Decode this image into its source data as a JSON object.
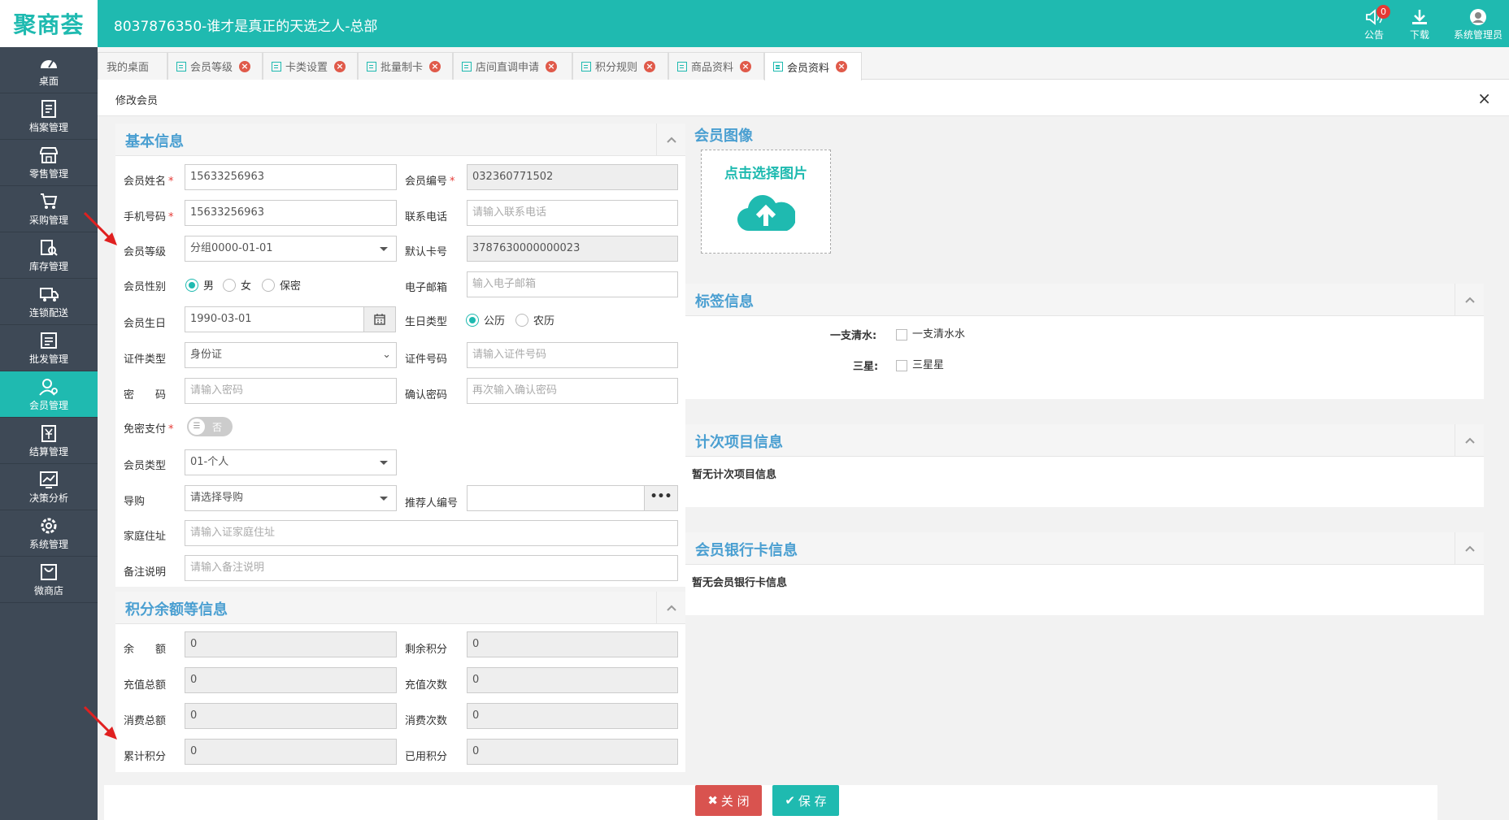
{
  "app": {
    "logo_text": "聚商荟",
    "shop_title": "8037876350-谁才是真正的天选之人-总部",
    "notice_label": "公告",
    "notice_count": "0",
    "download_label": "下载",
    "user_label": "系统管理员"
  },
  "sidebar": {
    "items": [
      {
        "label": "桌面",
        "icon": "dashboard-icon"
      },
      {
        "label": "档案管理",
        "icon": "archive-icon"
      },
      {
        "label": "零售管理",
        "icon": "store-icon"
      },
      {
        "label": "采购管理",
        "icon": "cart-icon"
      },
      {
        "label": "库存管理",
        "icon": "inventory-icon"
      },
      {
        "label": "连锁配送",
        "icon": "truck-icon"
      },
      {
        "label": "批发管理",
        "icon": "wholesale-icon"
      },
      {
        "label": "会员管理",
        "icon": "member-icon"
      },
      {
        "label": "结算管理",
        "icon": "settlement-icon"
      },
      {
        "label": "决策分析",
        "icon": "chart-icon"
      },
      {
        "label": "系统管理",
        "icon": "gear-icon"
      },
      {
        "label": "微商店",
        "icon": "shop-bag-icon"
      }
    ]
  },
  "tabs": [
    {
      "label": "我的桌面"
    },
    {
      "label": "会员等级"
    },
    {
      "label": "卡类设置"
    },
    {
      "label": "批量制卡"
    },
    {
      "label": "店间直调申请"
    },
    {
      "label": "积分规则"
    },
    {
      "label": "商品资料"
    },
    {
      "label": "会员资料"
    }
  ],
  "page": {
    "title": "修改会员",
    "close_symbol": "×"
  },
  "basic": {
    "title": "基本信息",
    "name_label": "会员姓名",
    "name_value": "15633256963",
    "code_label": "会员编号",
    "code_value": "032360771502",
    "phone_label": "手机号码",
    "phone_value": "15633256963",
    "contact_label": "联系电话",
    "contact_placeholder": "请输入联系电话",
    "level_label": "会员等级",
    "level_value": "分组0000-01-01",
    "card_label": "默认卡号",
    "card_value": "3787630000000023",
    "gender_label": "会员性别",
    "gender_male": "男",
    "gender_female": "女",
    "gender_secret": "保密",
    "email_label": "电子邮箱",
    "email_placeholder": "输入电子邮箱",
    "birthday_label": "会员生日",
    "birthday_value": "1990-03-01",
    "birth_type_label": "生日类型",
    "birth_solar": "公历",
    "birth_lunar": "农历",
    "id_type_label": "证件类型",
    "id_type_value": "身份证",
    "id_no_label": "证件号码",
    "id_no_placeholder": "请输入证件号码",
    "pwd_label": "密　　码",
    "pwd_placeholder": "请输入密码",
    "pwd2_label": "确认密码",
    "pwd2_placeholder": "再次输入确认密码",
    "nopwd_label": "免密支付",
    "nopwd_value": "否",
    "mtype_label": "会员类型",
    "mtype_value": "01-个人",
    "guide_label": "导购",
    "guide_value": "请选择导购",
    "referrer_label": "推荐人编号",
    "referrer_btn": "•••",
    "address_label": "家庭住址",
    "address_placeholder": "请输入证家庭住址",
    "remark_label": "备注说明",
    "remark_placeholder": "请输入备注说明"
  },
  "points": {
    "title": "积分余额等信息",
    "balance_label": "余　　额",
    "balance_value": "0",
    "remain_label": "剩余积分",
    "remain_value": "0",
    "recharge_total_label": "充值总额",
    "recharge_total_value": "0",
    "recharge_count_label": "充值次数",
    "recharge_count_value": "0",
    "consume_total_label": "消费总额",
    "consume_total_value": "0",
    "consume_count_label": "消费次数",
    "consume_count_value": "0",
    "accum_label": "累计积分",
    "accum_value": "0",
    "used_label": "已用积分",
    "used_value": "0"
  },
  "avatar": {
    "title": "会员图像",
    "upload_text": "点击选择图片"
  },
  "tags": {
    "title": "标签信息",
    "rows": [
      {
        "label": "一支清水:",
        "option": "一支清水水"
      },
      {
        "label": "三星:",
        "option": "三星星"
      }
    ]
  },
  "count_items": {
    "title": "计次项目信息",
    "empty": "暂无计次项目信息"
  },
  "bank": {
    "title": "会员银行卡信息",
    "empty": "暂无会员银行卡信息"
  },
  "footer": {
    "close_label": "关 闭",
    "save_label": "保 存"
  },
  "colors": {
    "brand": "#1fbab0",
    "sidebar": "#3e4956",
    "danger": "#d9534f",
    "heading": "#4a9fd1"
  }
}
